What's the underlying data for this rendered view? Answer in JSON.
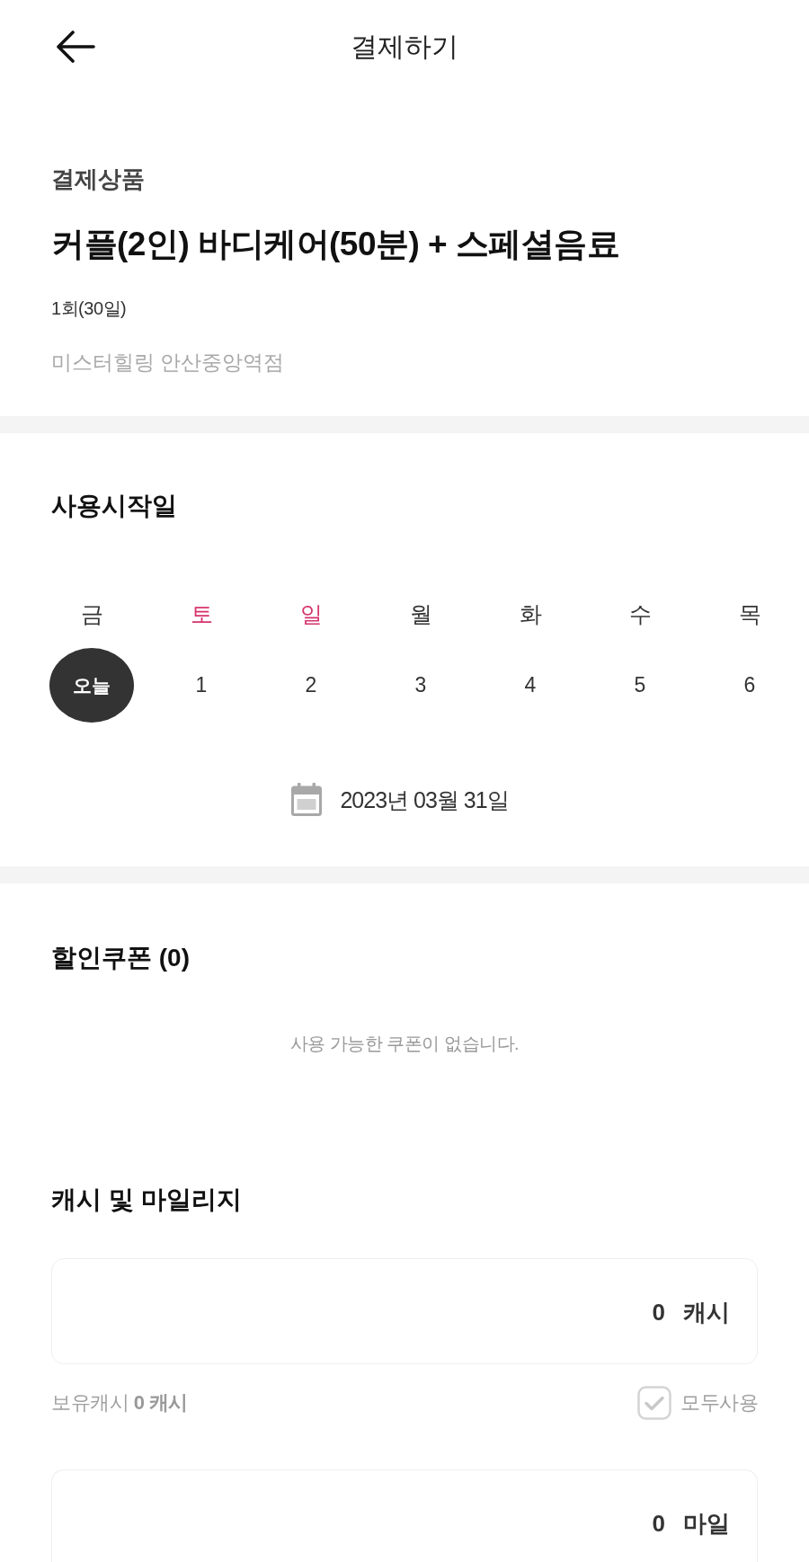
{
  "header": {
    "title": "결제하기"
  },
  "product": {
    "section_label": "결제상품",
    "name": "커플(2인) 바디케어(50분) + 스페셜음료",
    "period": "1회(30일)",
    "store": "미스터힐링 안산중앙역점"
  },
  "start_date": {
    "title": "사용시작일",
    "weekdays": [
      {
        "label": "금",
        "color": "#333333"
      },
      {
        "label": "토",
        "color": "#d6336c"
      },
      {
        "label": "일",
        "color": "#d6336c"
      },
      {
        "label": "월",
        "color": "#333333"
      },
      {
        "label": "화",
        "color": "#333333"
      },
      {
        "label": "수",
        "color": "#333333"
      },
      {
        "label": "목",
        "color": "#333333"
      }
    ],
    "dates": [
      {
        "label": "오늘",
        "selected": true
      },
      {
        "label": "1",
        "selected": false
      },
      {
        "label": "2",
        "selected": false
      },
      {
        "label": "3",
        "selected": false
      },
      {
        "label": "4",
        "selected": false
      },
      {
        "label": "5",
        "selected": false
      },
      {
        "label": "6",
        "selected": false
      }
    ],
    "selected_date": "2023년 03월 31일"
  },
  "coupon": {
    "title": "할인쿠폰 (0)",
    "empty_message": "사용 가능한 쿠폰이 없습니다."
  },
  "cash_mileage": {
    "title": "캐시 및 마일리지",
    "fields": [
      {
        "value": "0",
        "unit": "캐시",
        "balance": "보유캐시 **0 캐시**",
        "use_all": {
          "label": "모두사용",
          "checked": false
        }
      },
      {
        "value": "0",
        "unit": "마일"
      }
    ]
  }
}
